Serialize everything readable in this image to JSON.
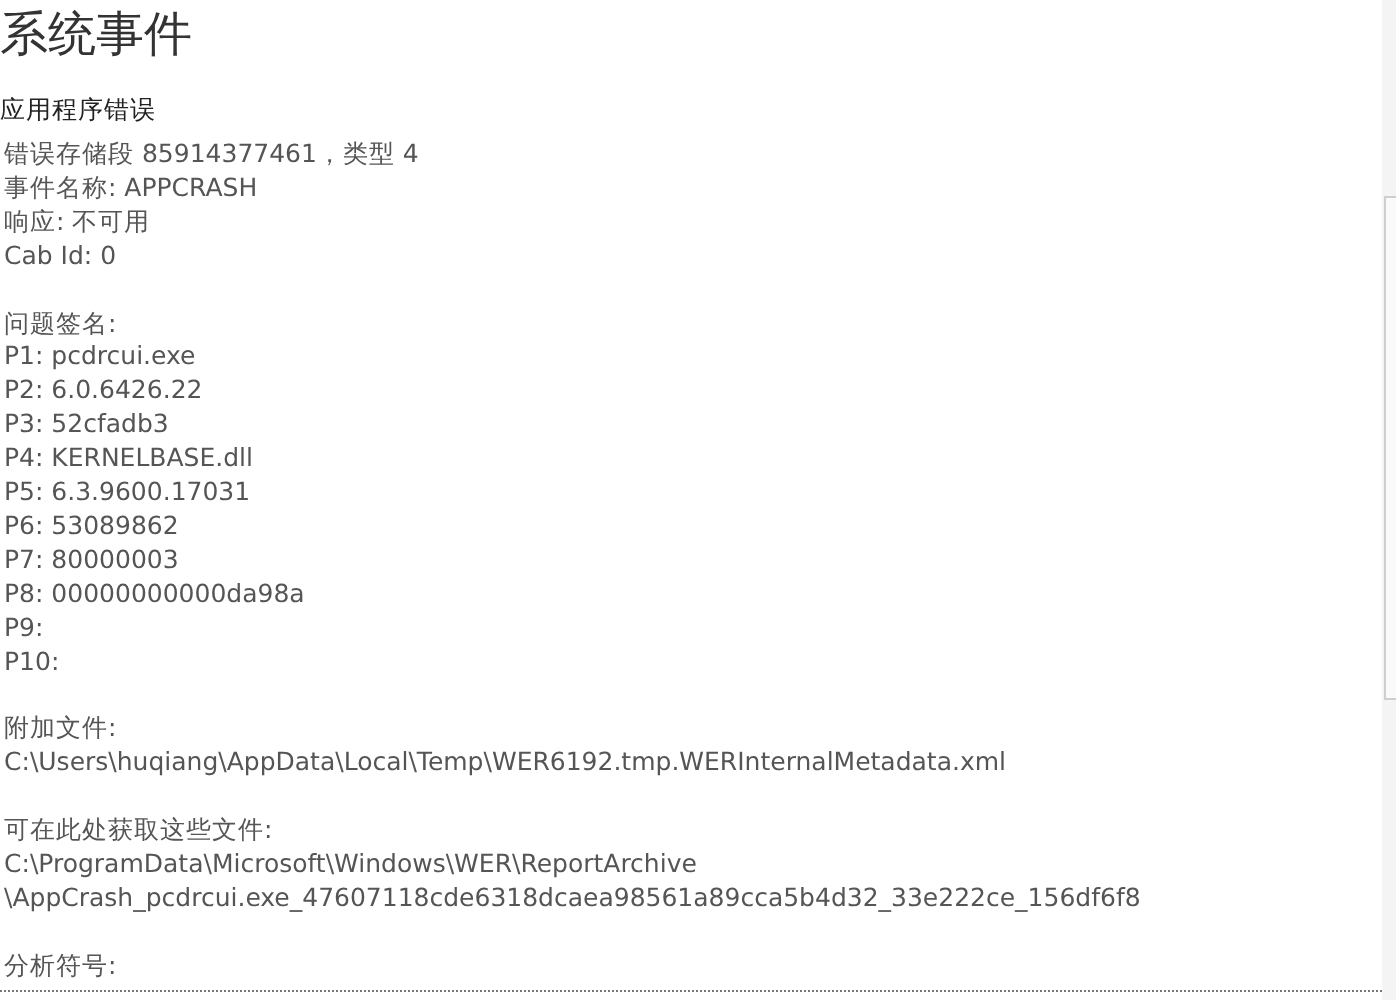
{
  "title": "系统事件",
  "heading": "应用程序错误",
  "groups": [
    [
      "错误存储段 85914377461，类型 4",
      "事件名称: APPCRASH",
      "响应: 不可用",
      "Cab Id: 0"
    ],
    [
      "问题签名:",
      "P1: pcdrcui.exe",
      "P2: 6.0.6426.22",
      "P3: 52cfadb3",
      "P4: KERNELBASE.dll",
      "P5: 6.3.9600.17031",
      "P6: 53089862",
      "P7: 80000003",
      "P8: 00000000000da98a",
      "P9:",
      "P10:"
    ],
    [
      "附加文件:",
      "C:\\Users\\huqiang\\AppData\\Local\\Temp\\WER6192.tmp.WERInternalMetadata.xml"
    ],
    [
      "可在此处获取这些文件:",
      "C:\\ProgramData\\Microsoft\\Windows\\WER\\ReportArchive",
      "\\AppCrash_pcdrcui.exe_47607118cde6318dcaea98561a89cca5b4d32_33e222ce_156df6f8"
    ],
    [
      "分析符号:"
    ]
  ]
}
